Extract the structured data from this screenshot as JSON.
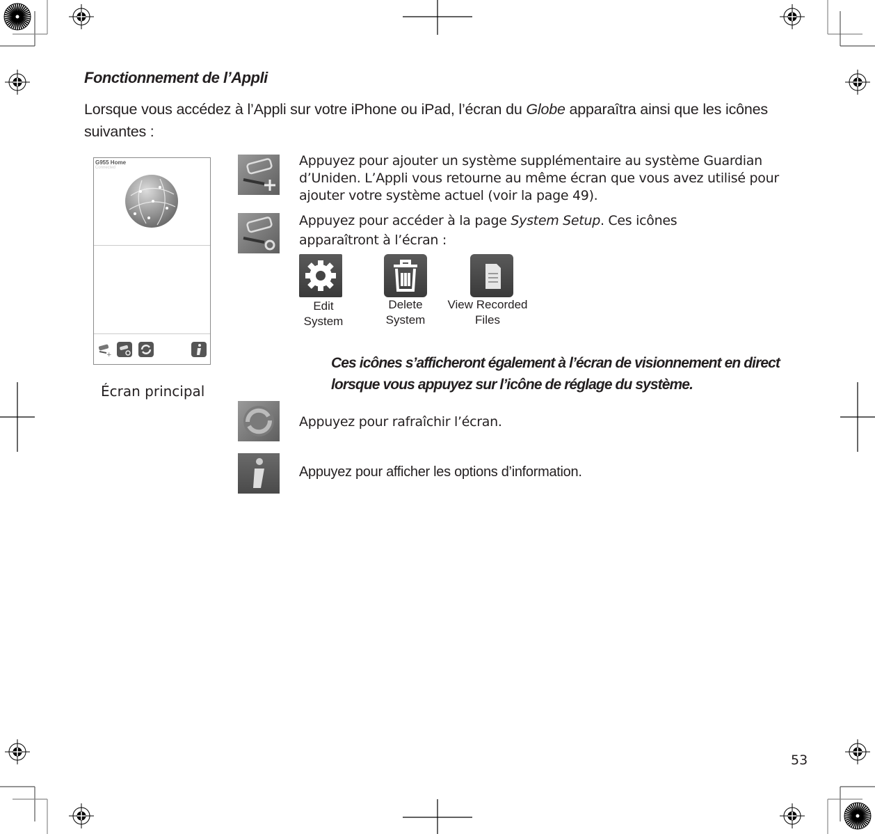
{
  "heading": "Fonctionnement de l’Appli",
  "intro": {
    "before": "Lorsque vous accédez à l’Appli sur votre iPhone ou iPad, l’écran du ",
    "emph": "Globe",
    "after": " apparaîtra ainsi que les icônes suivantes :"
  },
  "phone_screen": {
    "title": "G955 Home",
    "subtitle": "Connected",
    "toolbar_icons": [
      "add-camera-icon",
      "camera-settings-icon",
      "refresh-icon",
      "info-icon"
    ],
    "caption": "Écran principal"
  },
  "rows": [
    {
      "icon": "add-camera-icon",
      "text": "Appuyez pour ajouter un système supplémentaire au système Guardian d’Uniden. L’Appli vous retourne au même écran que vous avez utilisé pour ajouter votre système actuel (voir la page 49)."
    },
    {
      "icon": "camera-settings-icon",
      "text_before": "Appuyez pour accéder à la page ",
      "emph": "System Setup",
      "text_after": ". Ces icônes apparaîtront à l’écran :"
    },
    {
      "icon": "refresh-icon",
      "text": "Appuyez pour rafraîchir l’écran."
    },
    {
      "icon": "info-icon",
      "text": "Appuyez pour afficher les options d’information."
    }
  ],
  "setup_icons": [
    {
      "icon": "gear-icon",
      "label_line1": "Edit",
      "label_line2": "System"
    },
    {
      "icon": "trash-icon",
      "label_line1": "Delete",
      "label_line2": "System"
    },
    {
      "icon": "document-icon",
      "label_line1": "View Recorded",
      "label_line2": "Files"
    }
  ],
  "note": "Ces icônes s’afficheront également à l’écran de visionnement en direct lorsque vous appuyez sur l’icône de réglage du système.",
  "page_number": "53"
}
